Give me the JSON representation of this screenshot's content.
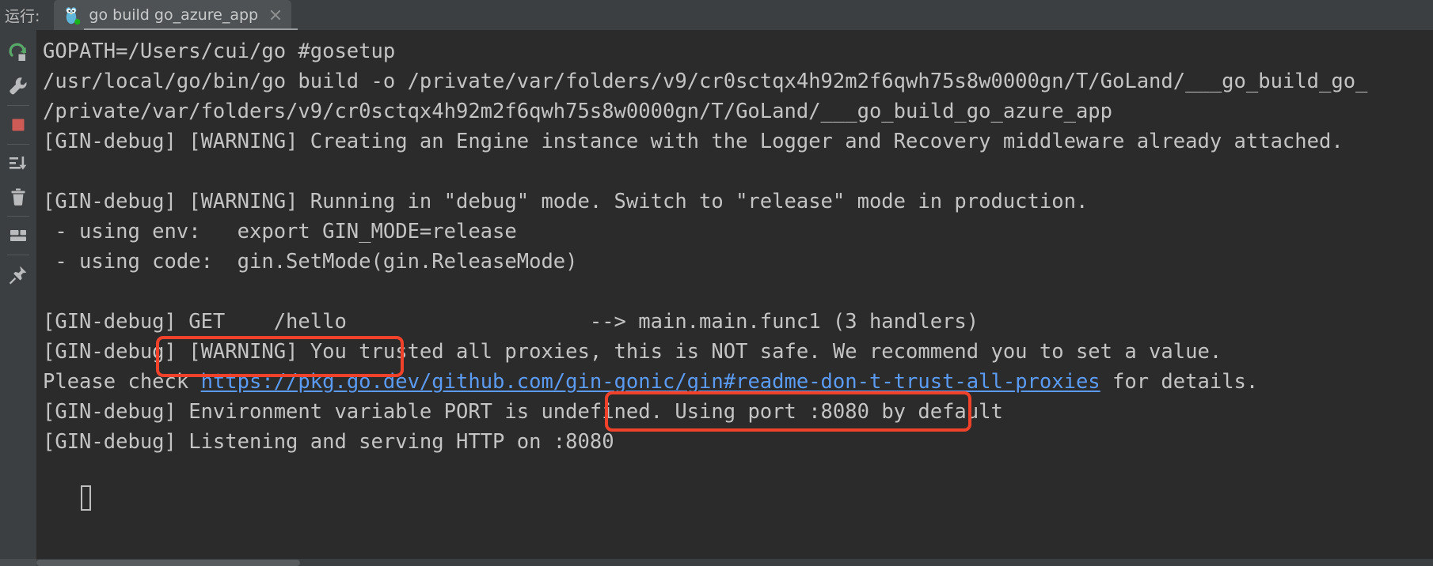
{
  "header": {
    "run_label": "运行:",
    "tab_title": "go build go_azure_app",
    "tab_icon": "go-gopher-icon",
    "close_icon": "close-icon"
  },
  "toolstrip": {
    "items": [
      {
        "name": "rerun-button",
        "icon": "rerun-icon",
        "label": "Rerun"
      },
      {
        "name": "edit-configuration",
        "icon": "wrench-icon",
        "label": "Modify Run Configuration"
      },
      {
        "name": "stop-button",
        "icon": "stop-square-icon",
        "label": "Stop"
      },
      {
        "name": "scroll-to-end-button",
        "icon": "scroll-to-end-icon",
        "label": "Scroll to End"
      },
      {
        "name": "clear-all-button",
        "icon": "trash-icon",
        "label": "Clear All"
      },
      {
        "name": "layout-button",
        "icon": "layout-icon",
        "label": "Layout"
      },
      {
        "name": "pin-tab-button",
        "icon": "pin-icon",
        "label": "Pin Tab"
      }
    ]
  },
  "console": {
    "lines": [
      {
        "id": "line-gopath",
        "text": "GOPATH=/Users/cui/go #gosetup"
      },
      {
        "id": "line-build-cmd",
        "text": "/usr/local/go/bin/go build -o /private/var/folders/v9/cr0sctqx4h92m2f6qwh75s8w0000gn/T/GoLand/___go_build_go_"
      },
      {
        "id": "line-binary-path",
        "text": "/private/var/folders/v9/cr0sctqx4h92m2f6qwh75s8w0000gn/T/GoLand/___go_build_go_azure_app"
      },
      {
        "id": "line-engine",
        "text": "[GIN-debug] [WARNING] Creating an Engine instance with the Logger and Recovery middleware already attached."
      },
      {
        "id": "line-blank-1",
        "text": " "
      },
      {
        "id": "line-debug-mode",
        "text": "[GIN-debug] [WARNING] Running in \"debug\" mode. Switch to \"release\" mode in production."
      },
      {
        "id": "line-using-env",
        "text": " - using env:   export GIN_MODE=release"
      },
      {
        "id": "line-using-code",
        "text": " - using code:  gin.SetMode(gin.ReleaseMode)"
      },
      {
        "id": "line-blank-2",
        "text": " "
      },
      {
        "id": "line-route-get",
        "text": "[GIN-debug] GET    /hello                    --> main.main.func1 (3 handlers)"
      },
      {
        "id": "line-proxies",
        "text": "[GIN-debug] [WARNING] You trusted all proxies, this is NOT safe. We recommend you to set a value."
      },
      {
        "id": "line-listening",
        "text": "[GIN-debug] Listening and serving HTTP on :8080"
      }
    ],
    "link_line": {
      "id": "line-please-check",
      "prefix": "Please check ",
      "link_text": "https://pkg.go.dev/github.com/gin-gonic/gin#readme-don-t-trust-all-proxies",
      "suffix": " for details."
    },
    "port_line": {
      "id": "line-port-undefined",
      "prefix": "[GIN-debug] Environment variable PORT is undefined. ",
      "highlighted": "Using port :8080 by default"
    },
    "caret_name": "console-caret"
  },
  "annotations": [
    {
      "name": "annotation-box-route-get",
      "target": "GET    /hello"
    },
    {
      "name": "annotation-box-using-port",
      "target": "Using port :8080 by default"
    }
  ],
  "colors": {
    "background": "#2b2b2b",
    "chrome": "#3c3f41",
    "tab_active": "#4e5254",
    "text": "#c4c4c4",
    "link": "#5b9bf3",
    "annotation": "#f0412a",
    "stop_red": "#cf5b56",
    "rerun_green": "#59a869"
  }
}
